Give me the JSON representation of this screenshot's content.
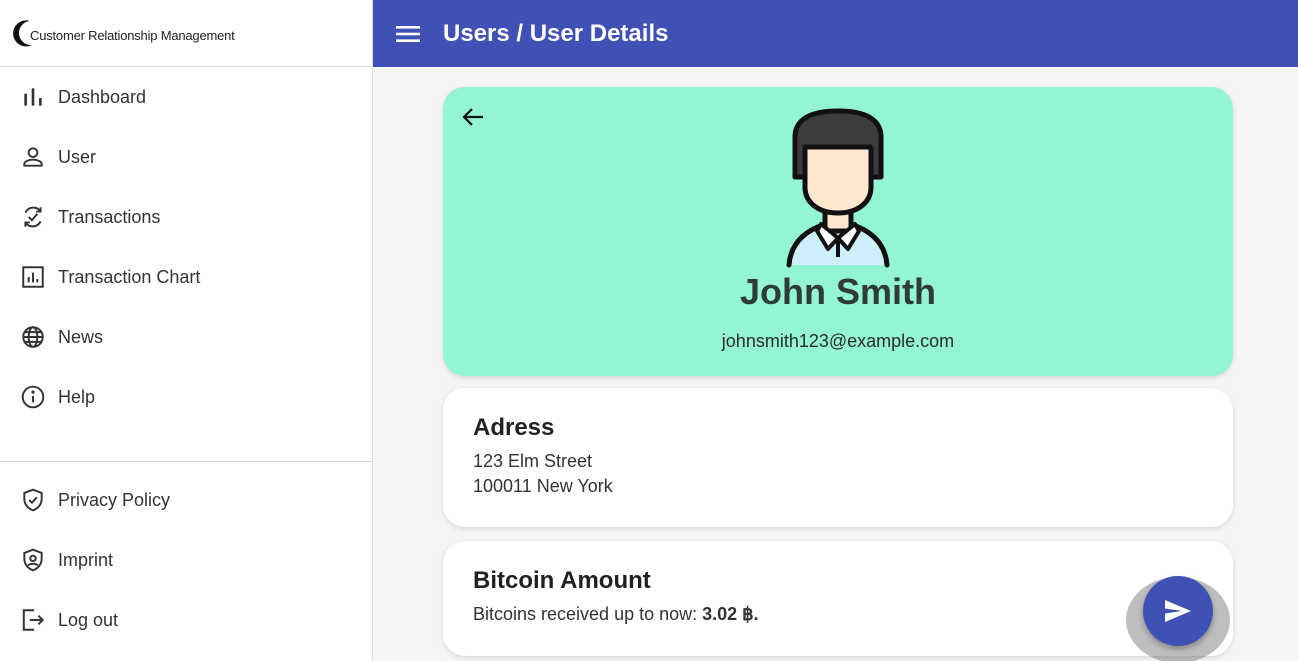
{
  "app": {
    "logo_text": "Customer Relationship Management"
  },
  "sidebar": {
    "items": [
      {
        "label": "Dashboard",
        "icon": "bar-chart-icon"
      },
      {
        "label": "User",
        "icon": "person-icon"
      },
      {
        "label": "Transactions",
        "icon": "transactions-icon"
      },
      {
        "label": "Transaction Chart",
        "icon": "chart-box-icon"
      },
      {
        "label": "News",
        "icon": "globe-icon"
      },
      {
        "label": "Help",
        "icon": "info-icon"
      }
    ],
    "bottom_items": [
      {
        "label": "Privacy Policy",
        "icon": "shield-check-icon"
      },
      {
        "label": "Imprint",
        "icon": "shield-person-icon"
      },
      {
        "label": "Log out",
        "icon": "logout-icon"
      }
    ]
  },
  "header": {
    "title": "Users / User Details"
  },
  "profile": {
    "name": "John Smith",
    "email": "johnsmith123@example.com"
  },
  "address": {
    "title": "Adress",
    "street": "123 Elm Street",
    "city": "100011 New York"
  },
  "bitcoin": {
    "title": "Bitcoin Amount",
    "label": "Bitcoins received up to now:",
    "value": "3.02 ฿."
  },
  "colors": {
    "primary": "#3f51b5",
    "hero_background": "#93f5d4"
  }
}
